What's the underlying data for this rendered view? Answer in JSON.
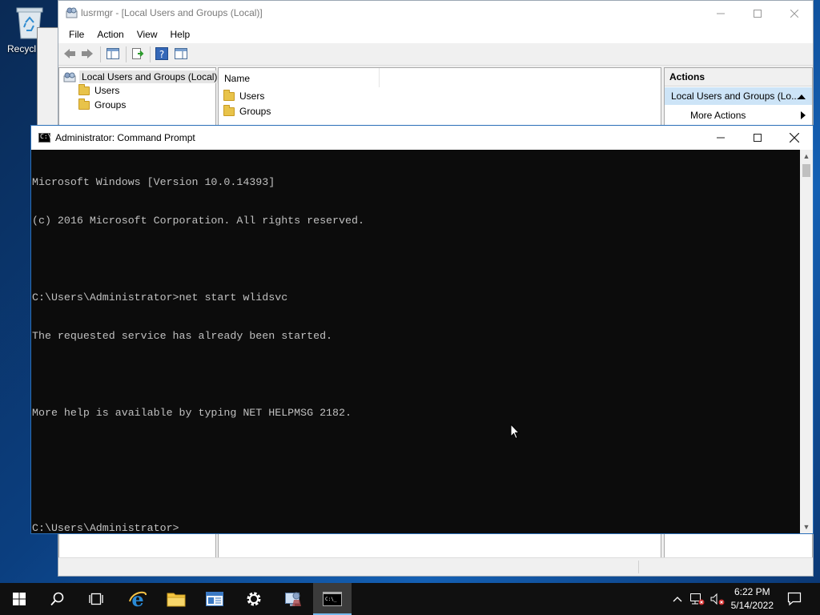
{
  "desktop": {
    "recycle_bin_label": "Recycl"
  },
  "mmc": {
    "title": "lusrmgr - [Local Users and Groups (Local)]",
    "menu": [
      "File",
      "Action",
      "View",
      "Help"
    ],
    "tree": {
      "root": "Local Users and Groups (Local)",
      "children": [
        "Users",
        "Groups"
      ]
    },
    "list": {
      "column_name": "Name",
      "items": [
        "Users",
        "Groups"
      ]
    },
    "actions": {
      "header": "Actions",
      "selected": "Local Users and Groups (Lo...",
      "more": "More Actions"
    }
  },
  "cmd": {
    "title": "Administrator: Command Prompt",
    "lines": [
      "Microsoft Windows [Version 10.0.14393]",
      "(c) 2016 Microsoft Corporation. All rights reserved.",
      "",
      "C:\\Users\\Administrator>net start wlidsvc",
      "The requested service has already been started.",
      "",
      "More help is available by typing NET HELPMSG 2182.",
      "",
      "",
      "C:\\Users\\Administrator>"
    ]
  },
  "taskbar": {
    "time": "6:22 PM",
    "date": "5/14/2022"
  },
  "colors": {
    "console_bg": "#0c0c0c",
    "console_fg": "#c0c0c0",
    "taskbar_bg": "#101010",
    "active_accent": "#76b9ed",
    "selection": "#cde4f7"
  }
}
